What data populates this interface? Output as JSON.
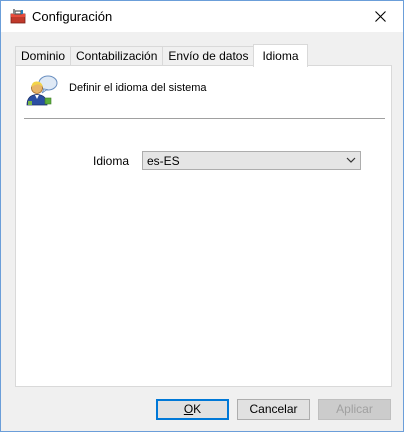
{
  "window": {
    "title": "Configuración"
  },
  "tabs": [
    {
      "label": "Dominio"
    },
    {
      "label": "Contabilización"
    },
    {
      "label": "Envío de datos"
    },
    {
      "label": "Idioma"
    }
  ],
  "active_tab": "Idioma",
  "panel": {
    "header_text": "Definir el idioma del sistema",
    "language_label": "Idioma",
    "language_value": "es-ES"
  },
  "buttons": {
    "ok_mnemonic": "O",
    "ok_rest": "K",
    "cancel_label": "Cancelar",
    "apply_label": "Aplicar"
  },
  "colors": {
    "accent": "#0078d7",
    "window_border": "#6b9ed9"
  }
}
